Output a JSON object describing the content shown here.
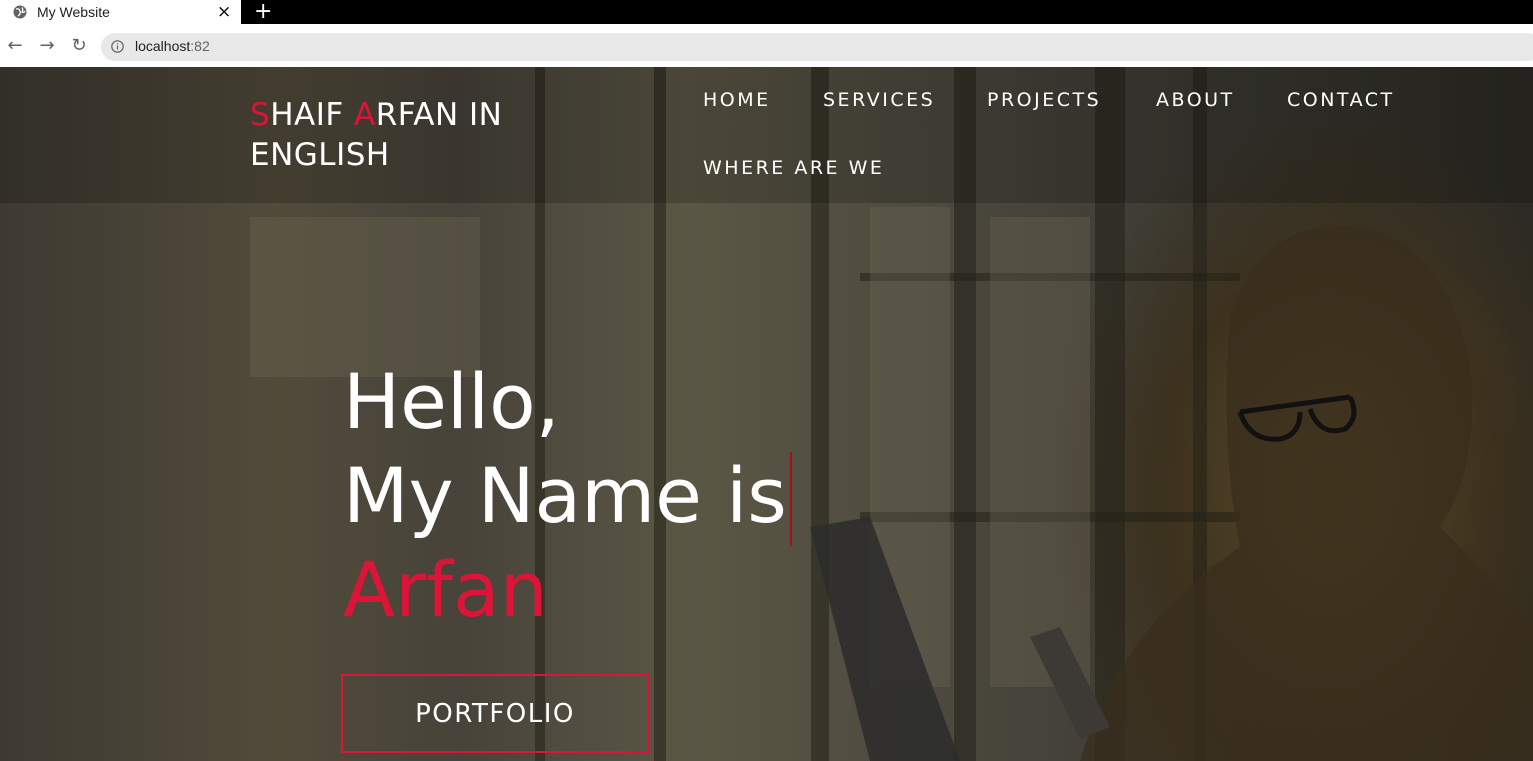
{
  "browser": {
    "tab_title": "My Website",
    "tab_close": "×",
    "new_tab": "+",
    "url_host": "localhost",
    "url_port": ":82",
    "back": "←",
    "forward": "→",
    "reload": "↻"
  },
  "brand": {
    "line1_accent1": "S",
    "line1_part1": "HAIF ",
    "line1_accent2": "A",
    "line1_part2": "RFAN IN",
    "line2": "ENGLISH",
    "accent_color": "#dc1437"
  },
  "nav": {
    "items": [
      {
        "label": "HOME"
      },
      {
        "label": "SERVICES"
      },
      {
        "label": "PROJECTS"
      },
      {
        "label": "ABOUT"
      },
      {
        "label": "CONTACT"
      },
      {
        "label": "WHERE ARE WE"
      }
    ]
  },
  "hero": {
    "line1": "Hello,",
    "line2": "My Name is",
    "name": "Arfan",
    "button_label": "PORTFOLIO"
  }
}
